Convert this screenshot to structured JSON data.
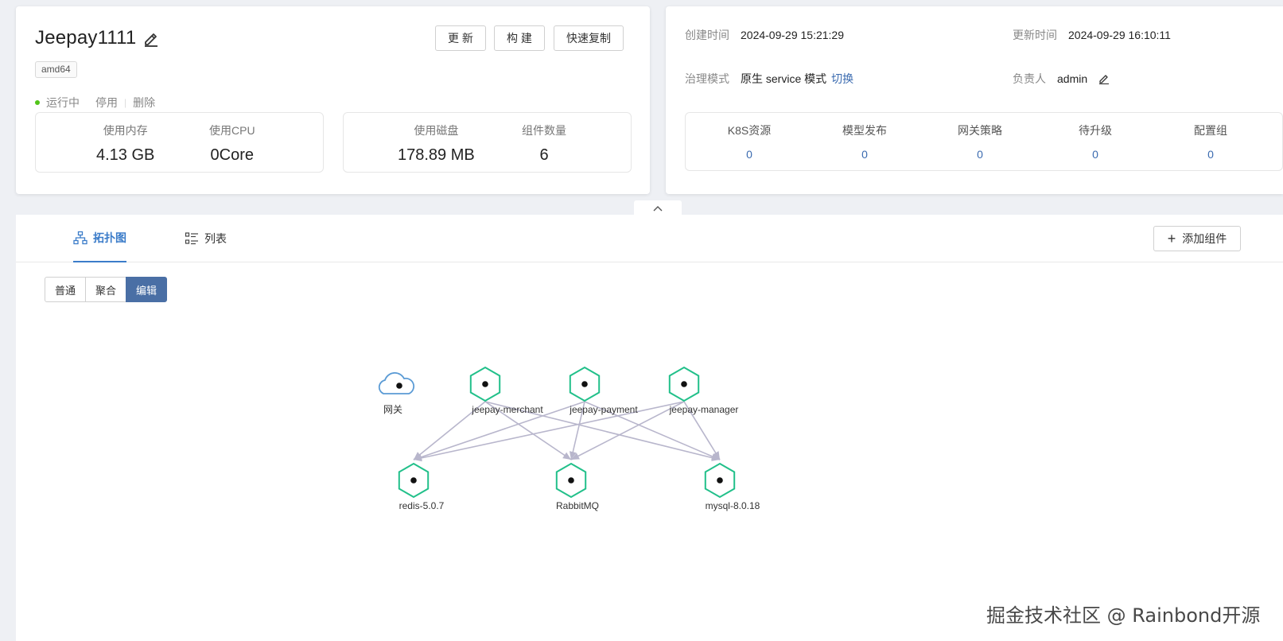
{
  "app": {
    "title": "Jeepay1111",
    "arch": "amd64",
    "status": "运行中",
    "actions": {
      "stop": "停用",
      "delete": "删除"
    },
    "buttons": {
      "update": "更 新",
      "build": "构 建",
      "copy": "快速复制"
    },
    "stats": [
      {
        "label": "使用内存",
        "value": "4.13 GB"
      },
      {
        "label": "使用CPU",
        "value": "0Core"
      },
      {
        "label": "使用磁盘",
        "value": "178.89 MB"
      },
      {
        "label": "组件数量",
        "value": "6"
      }
    ]
  },
  "meta": {
    "created_label": "创建时间",
    "created": "2024-09-29 15:21:29",
    "updated_label": "更新时间",
    "updated": "2024-09-29 16:10:11",
    "mode_label": "治理模式",
    "mode": "原生 service 模式",
    "switch": "切换",
    "owner_label": "负责人",
    "owner": "admin"
  },
  "counts": [
    {
      "label": "K8S资源",
      "value": "0"
    },
    {
      "label": "模型发布",
      "value": "0"
    },
    {
      "label": "网关策略",
      "value": "0"
    },
    {
      "label": "待升级",
      "value": "0"
    },
    {
      "label": "配置组",
      "value": "0"
    }
  ],
  "tabs": {
    "topology": "拓扑图",
    "list": "列表"
  },
  "add_component": "添加组件",
  "view_modes": {
    "normal": "普通",
    "aggregate": "聚合",
    "edit": "编辑"
  },
  "topology": {
    "nodes": [
      {
        "id": "gateway",
        "label": "网关",
        "kind": "gateway-cloud-icon"
      },
      {
        "id": "merchant",
        "label": "jeepay-merchant",
        "kind": "hexagon-icon"
      },
      {
        "id": "payment",
        "label": "jeepay-payment",
        "kind": "hexagon-icon"
      },
      {
        "id": "manager",
        "label": "jeepay-manager",
        "kind": "hexagon-icon"
      },
      {
        "id": "redis",
        "label": "redis-5.0.7",
        "kind": "hexagon-icon"
      },
      {
        "id": "rabbitmq",
        "label": "RabbitMQ",
        "kind": "hexagon-icon"
      },
      {
        "id": "mysql",
        "label": "mysql-8.0.18",
        "kind": "hexagon-icon"
      }
    ],
    "edges": [
      [
        "merchant",
        "redis"
      ],
      [
        "merchant",
        "rabbitmq"
      ],
      [
        "merchant",
        "mysql"
      ],
      [
        "payment",
        "redis"
      ],
      [
        "payment",
        "rabbitmq"
      ],
      [
        "payment",
        "mysql"
      ],
      [
        "manager",
        "redis"
      ],
      [
        "manager",
        "rabbitmq"
      ],
      [
        "manager",
        "mysql"
      ]
    ]
  },
  "colors": {
    "node": "#22c08a",
    "edge": "#b8b6cc",
    "accent": "#3b7cc9",
    "active": "#4a6fa5",
    "running": "#52c41a"
  },
  "watermark": "掘金技术社区 @ Rainbond开源"
}
